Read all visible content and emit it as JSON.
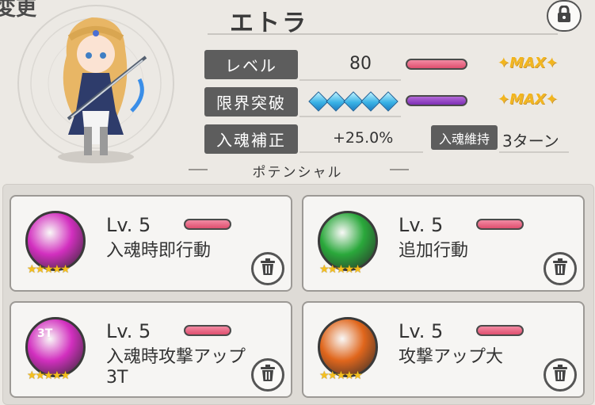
{
  "header": {
    "top_left_text": "変更",
    "char_name": "エトラ"
  },
  "stats": {
    "level_label": "レベル",
    "level_value": "80",
    "level_max": "✦MAX✦",
    "limit_label": "限界突破",
    "limit_diamonds": 5,
    "limit_max": "✦MAX✦",
    "soul_label": "入魂補正",
    "soul_value": "+25.0%",
    "sustain_label": "入魂維持",
    "sustain_value": "3ターン"
  },
  "potential": {
    "title": "ポテンシャル",
    "skills": [
      {
        "level": "Lv. 5",
        "name": "入魂時即行動",
        "icon": "magenta-person-emblem-icon",
        "color": "#d22fbf",
        "stars": "★★★★★"
      },
      {
        "level": "Lv. 5",
        "name": "追加行動",
        "icon": "green-person-plus-icon",
        "color": "#2aa83b",
        "stars": "★★★★★"
      },
      {
        "level": "Lv. 5",
        "name": "入魂時攻撃アップ\n3T",
        "icon": "magenta-3t-sword-icon",
        "icon_text": "3T",
        "color": "#d22fbf",
        "stars": "★★★★★"
      },
      {
        "level": "Lv. 5",
        "name": "攻撃アップ大",
        "icon": "orange-sword-up-icon",
        "color": "#e0661c",
        "stars": "★★★★★"
      }
    ]
  },
  "colors": {
    "bar_pink": "#e0506f",
    "bar_purple": "#7d2eb4",
    "max_gold": "#f2b51e"
  }
}
